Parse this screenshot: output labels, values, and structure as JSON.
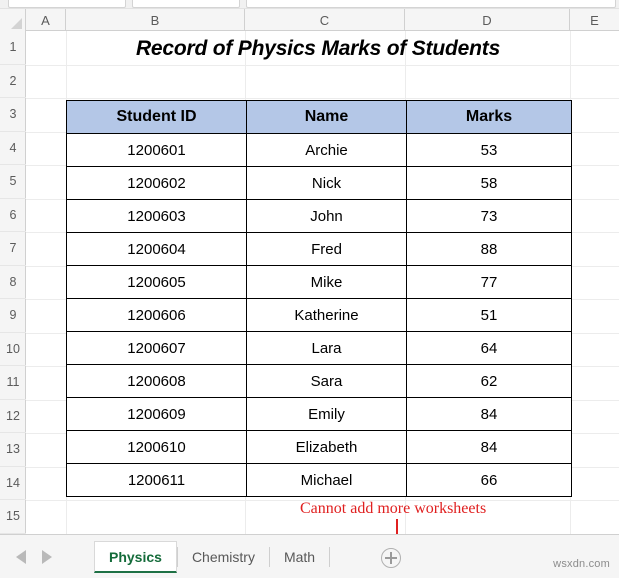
{
  "spreadsheet": {
    "title": "Record of Physics Marks of Students",
    "column_headers": [
      "A",
      "B",
      "C",
      "D",
      "E"
    ],
    "row_headers": [
      "1",
      "2",
      "3",
      "4",
      "5",
      "6",
      "7",
      "8",
      "9",
      "10",
      "11",
      "12",
      "13",
      "14",
      "15"
    ],
    "header_fill_color": "#B4C7E7",
    "border_color": "#000000"
  },
  "table": {
    "columns": [
      "Student ID",
      "Name",
      "Marks"
    ],
    "rows": [
      {
        "id": "1200601",
        "name": "Archie",
        "marks": "53"
      },
      {
        "id": "1200602",
        "name": "Nick",
        "marks": "58"
      },
      {
        "id": "1200603",
        "name": "John",
        "marks": "73"
      },
      {
        "id": "1200604",
        "name": "Fred",
        "marks": "88"
      },
      {
        "id": "1200605",
        "name": "Mike",
        "marks": "77"
      },
      {
        "id": "1200606",
        "name": "Katherine",
        "marks": "51"
      },
      {
        "id": "1200607",
        "name": "Lara",
        "marks": "64"
      },
      {
        "id": "1200608",
        "name": "Sara",
        "marks": "62"
      },
      {
        "id": "1200609",
        "name": "Emily",
        "marks": "84"
      },
      {
        "id": "1200610",
        "name": "Elizabeth",
        "marks": "84"
      },
      {
        "id": "1200611",
        "name": "Michael",
        "marks": "66"
      }
    ]
  },
  "annotation": {
    "text": "Cannot add more worksheets",
    "color": "#E02020"
  },
  "tabbar": {
    "sheets": [
      {
        "label": "Physics",
        "active": true
      },
      {
        "label": "Chemistry",
        "active": false
      },
      {
        "label": "Math",
        "active": false
      }
    ],
    "active_tab_color": "#1E7145",
    "add_sheet_label": "+"
  },
  "watermark": "wsxdn.com"
}
